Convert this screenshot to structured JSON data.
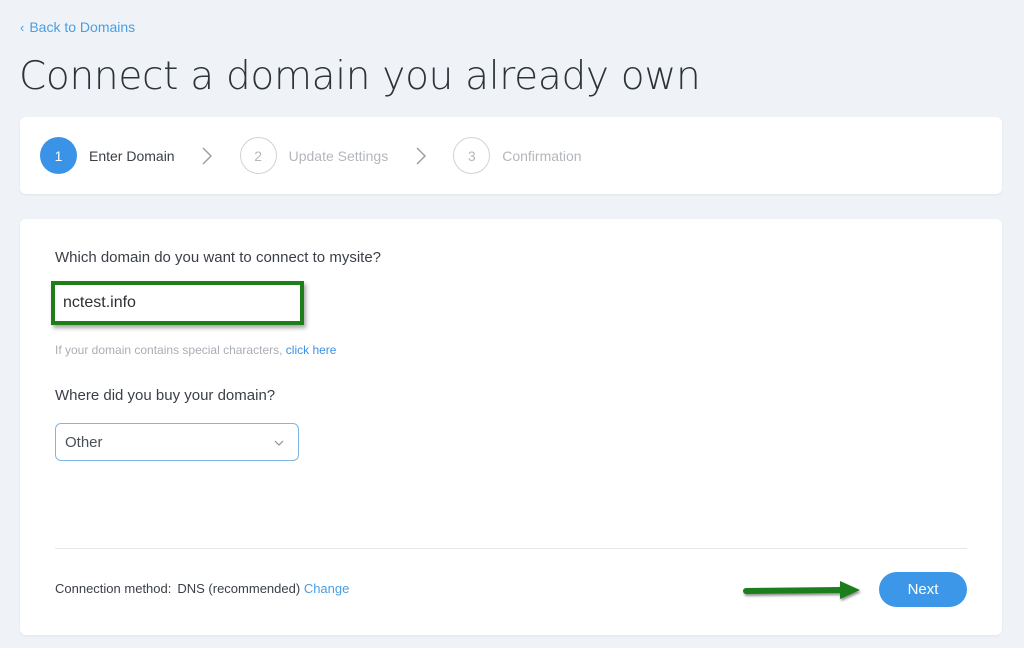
{
  "nav": {
    "back_label": "Back to Domains",
    "back_icon": "chevron-left-icon"
  },
  "header": {
    "title": "Connect a domain you already own"
  },
  "stepper": {
    "steps": [
      {
        "number": "1",
        "label": "Enter Domain",
        "state": "active"
      },
      {
        "number": "2",
        "label": "Update Settings",
        "state": "inactive"
      },
      {
        "number": "3",
        "label": "Confirmation",
        "state": "inactive"
      }
    ],
    "separator_icon": "chevron-right-icon"
  },
  "form": {
    "domain_question": "Which domain do you want to connect to mysite?",
    "domain_value": "nctest.info",
    "hint_text": "If your domain contains special characters,",
    "hint_link": "click here",
    "provider_question": "Where did you buy your domain?",
    "provider_selected": "Other",
    "connection_label": "Connection method:",
    "connection_value": "DNS (recommended)",
    "change_link": "Change",
    "next_label": "Next"
  },
  "colors": {
    "accent": "#3b93e7",
    "annotation_green": "#1f7d1a",
    "background": "#eff3f7"
  }
}
